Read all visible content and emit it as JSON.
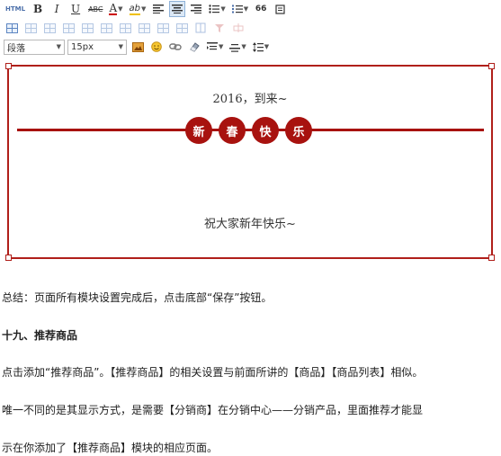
{
  "toolbar": {
    "html_label": "HTML",
    "bold_glyph": "B",
    "italic_glyph": "I",
    "underline_glyph": "U",
    "strike_glyph": "ABC",
    "font_color_glyph": "A",
    "highlight_glyph": "ab",
    "quote_glyph": "66",
    "paragraph_select": "段落",
    "fontsize_select": "15px"
  },
  "poster": {
    "title": "2016，到来~",
    "badges": [
      "新",
      "春",
      "快",
      "乐"
    ],
    "greeting": "祝大家新年快乐~",
    "accent_color": "#a8120f"
  },
  "content": {
    "summary": "总结：页面所有模块设置完成后，点击底部“保存”按钮。",
    "heading": "十九、推荐商品",
    "p1": "点击添加“推荐商品”。【推荐商品】的相关设置与前面所讲的【商品】【商品列表】相似。",
    "p2": "唯一不同的是其显示方式，是需要【分销商】在分销中心——分销产品，里面推荐才能显",
    "p3": "示在你添加了【推荐商品】模块的相应页面。"
  }
}
